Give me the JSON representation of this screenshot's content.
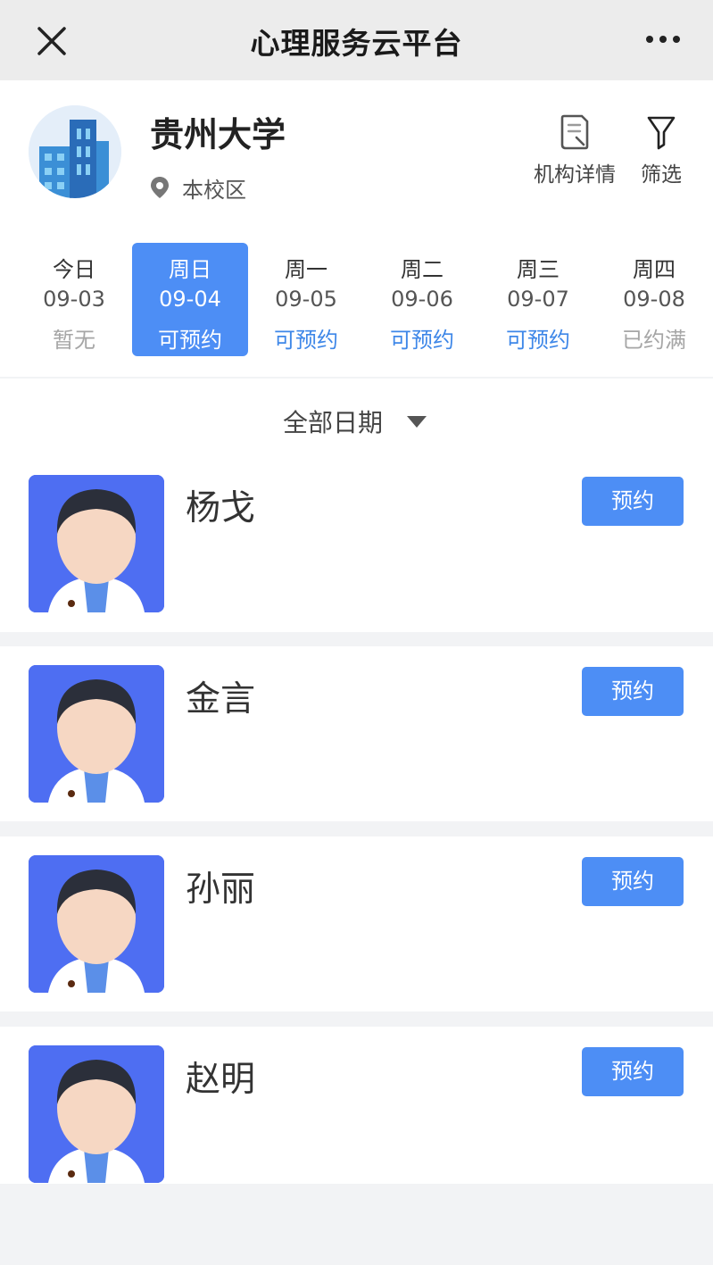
{
  "nav": {
    "title": "心理服务云平台",
    "close_icon": "close-icon",
    "more_icon": "more-dots-icon"
  },
  "org": {
    "name": "贵州大学",
    "location": "本校区",
    "detail_label": "机构详情",
    "filter_label": "筛选"
  },
  "dates": [
    {
      "weekday": "今日",
      "date": "09-03",
      "status": "暂无",
      "state": "none"
    },
    {
      "weekday": "周日",
      "date": "09-04",
      "status": "可预约",
      "state": "active"
    },
    {
      "weekday": "周一",
      "date": "09-05",
      "status": "可预约",
      "state": "avail"
    },
    {
      "weekday": "周二",
      "date": "09-06",
      "status": "可预约",
      "state": "avail"
    },
    {
      "weekday": "周三",
      "date": "09-07",
      "status": "可预约",
      "state": "avail"
    },
    {
      "weekday": "周四",
      "date": "09-08",
      "status": "已约满",
      "state": "full"
    }
  ],
  "date_filter": {
    "label": "全部日期"
  },
  "counselors": [
    {
      "name": "杨戈",
      "button": "预约"
    },
    {
      "name": "金言",
      "button": "预约"
    },
    {
      "name": "孙丽",
      "button": "预约"
    },
    {
      "name": "赵明",
      "button": "预约"
    }
  ],
  "colors": {
    "accent": "#4d8ef5",
    "available": "#3e87e8",
    "muted": "#a6a6a6",
    "avatar_bg": "#4e6ef2"
  }
}
